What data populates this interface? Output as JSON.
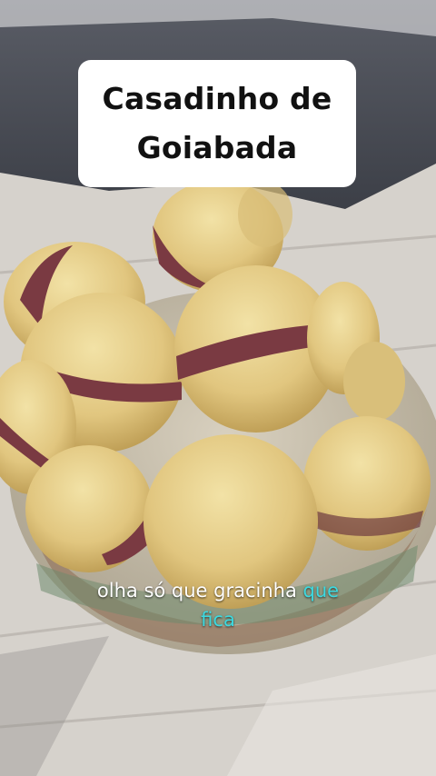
{
  "overlay": {
    "title_line1": "Casadinho de",
    "title_line2": "Goiabada"
  },
  "caption": {
    "text": "olha só que gracinha",
    "highlight1": "que",
    "highlight2": "fica"
  },
  "colors": {
    "highlight": "#3dd9e0",
    "title_box": "#ffffff"
  }
}
